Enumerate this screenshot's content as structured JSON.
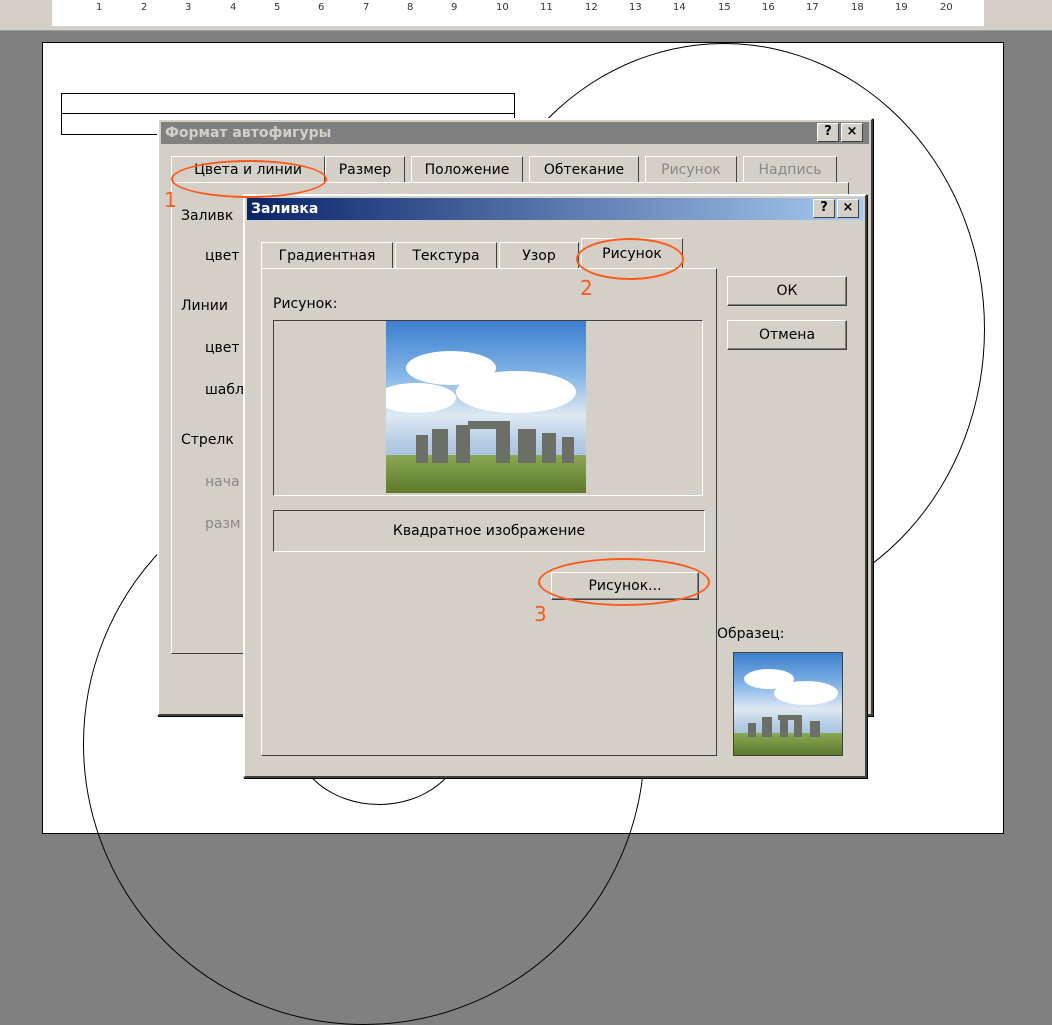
{
  "ruler": {
    "numbers": [
      "1",
      "2",
      "3",
      "4",
      "5",
      "6",
      "7",
      "8",
      "9",
      "10",
      "11",
      "12",
      "13",
      "14",
      "15",
      "16",
      "17",
      "18",
      "19",
      "20"
    ]
  },
  "format_dialog": {
    "title": "Формат автофигуры",
    "help": "?",
    "close": "×",
    "tabs": [
      {
        "label": "Цвета и линии",
        "active": true
      },
      {
        "label": "Размер"
      },
      {
        "label": "Положение"
      },
      {
        "label": "Обтекание"
      },
      {
        "label": "Рисунок",
        "disabled": true
      },
      {
        "label": "Надпись",
        "disabled": true
      }
    ],
    "section_fill": "Заливк",
    "fill_color": "цвет",
    "section_lines": "Линии",
    "line_color": "цвет",
    "line_pattern": "шабл",
    "section_arrows": "Стрелк",
    "arrow_start": "нача",
    "arrow_size": "разм"
  },
  "fill_dialog": {
    "title": "Заливка",
    "help": "?",
    "close": "×",
    "tabs": [
      {
        "label": "Градиентная"
      },
      {
        "label": "Текстура"
      },
      {
        "label": "Узор"
      },
      {
        "label": "Рисунок",
        "active": true
      }
    ],
    "picture_label": "Рисунок:",
    "picture_name": "Квадратное изображение",
    "select_picture_button": "Рисунок...",
    "ok_button": "ОК",
    "cancel_button": "Отмена",
    "sample_label": "Образец:"
  },
  "annotations": {
    "step1": "1",
    "step2": "2",
    "step3": "3",
    "color": "#ff5a1a"
  }
}
